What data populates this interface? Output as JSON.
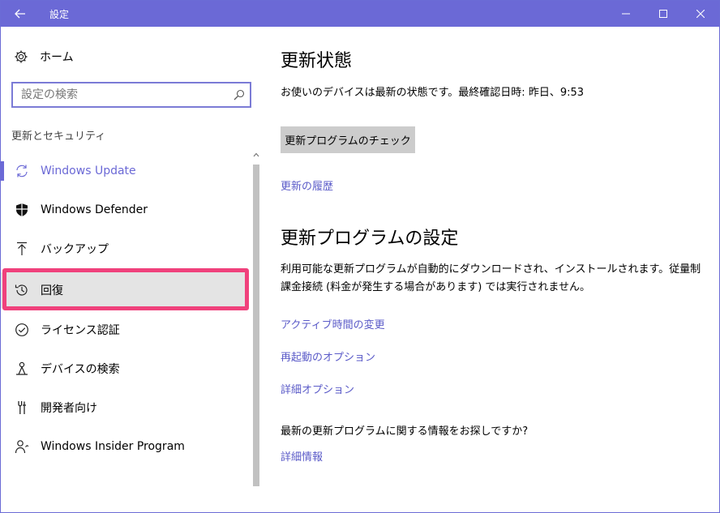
{
  "window": {
    "title": "設定"
  },
  "sidebar": {
    "home_label": "ホーム",
    "search_placeholder": "設定の検索",
    "section_title": "更新とセキュリティ",
    "items": [
      {
        "label": "Windows Update",
        "icon": "refresh-icon",
        "active": true
      },
      {
        "label": "Windows Defender",
        "icon": "shield-icon"
      },
      {
        "label": "バックアップ",
        "icon": "backup-arrow-icon"
      },
      {
        "label": "回復",
        "icon": "history-icon",
        "highlighted": true
      },
      {
        "label": "ライセンス認証",
        "icon": "check-circle-icon"
      },
      {
        "label": "デバイスの検索",
        "icon": "person-location-icon"
      },
      {
        "label": "開発者向け",
        "icon": "developer-tools-icon"
      },
      {
        "label": "Windows Insider Program",
        "icon": "insider-person-icon"
      }
    ]
  },
  "content": {
    "status_heading": "更新状態",
    "status_text": "お使いのデバイスは最新の状態です。最終確認日時: 昨日、9:53",
    "check_button": "更新プログラムのチェック",
    "history_link": "更新の履歴",
    "settings_heading": "更新プログラムの設定",
    "settings_text": "利用可能な更新プログラムが自動的にダウンロードされ、インストールされます。従量制課金接続 (料金が発生する場合があります) では実行されません。",
    "links": [
      "アクティブ時間の変更",
      "再起動のオプション",
      "詳細オプション"
    ],
    "info_question": "最新の更新プログラムに関する情報をお探しですか?",
    "info_link": "詳細情報"
  },
  "colors": {
    "accent": "#6b69d6",
    "highlight_box": "#f0417c",
    "link": "#5b5bc8"
  }
}
